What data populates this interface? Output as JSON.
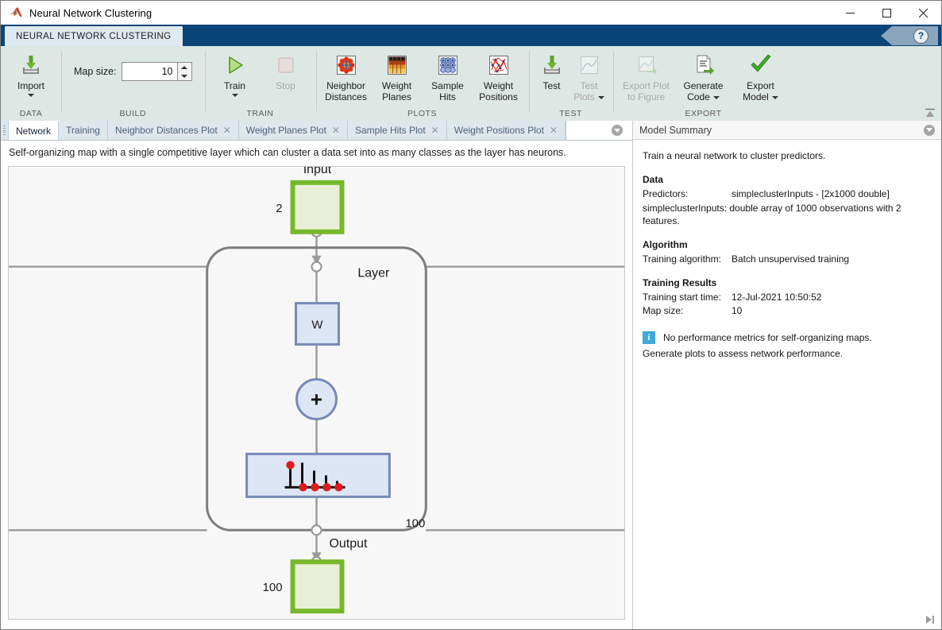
{
  "window": {
    "title": "Neural Network Clustering",
    "app_icon": "matlab-icon",
    "minimize": "–",
    "maximize": "☐",
    "close": "✕"
  },
  "ribbon": {
    "tab_label": "NEURAL NETWORK CLUSTERING",
    "help_label": "?",
    "collapse_label": "collapse-ribbon-icon",
    "groups": [
      {
        "title": "DATA",
        "items": [
          {
            "label": "Import",
            "icon": "import-data-icon",
            "has_caret": true,
            "disabled": false
          }
        ]
      },
      {
        "title": "BUILD",
        "field": {
          "label": "Map size:",
          "value": "10",
          "placeholder": "10"
        }
      },
      {
        "title": "TRAIN",
        "items": [
          {
            "label": "Train",
            "icon": "play-triangle-icon",
            "has_caret": true,
            "disabled": false
          },
          {
            "label": "Stop",
            "icon": "stop-square-icon",
            "has_caret": false,
            "disabled": true
          }
        ]
      },
      {
        "title": "PLOTS",
        "items": [
          {
            "label": "Neighbor\nDistances",
            "label_line1": "Neighbor",
            "label_line2": "Distances",
            "icon": "neighbor-distances-icon",
            "disabled": false
          },
          {
            "label": "Weight Planes",
            "label_line1": "Weight",
            "label_line2": "Planes",
            "icon": "weight-planes-icon",
            "disabled": false
          },
          {
            "label": "Sample Hits",
            "label_line1": "Sample",
            "label_line2": "Hits",
            "icon": "sample-hits-icon",
            "disabled": false
          },
          {
            "label": "Weight Positions",
            "label_line1": "Weight",
            "label_line2": "Positions",
            "icon": "weight-positions-icon",
            "disabled": false
          }
        ]
      },
      {
        "title": "TEST",
        "items": [
          {
            "label": "Test",
            "label_line1": "Test",
            "label_line2": "",
            "icon": "test-import-icon",
            "disabled": false
          },
          {
            "label": "Test Plots",
            "label_line1": "Test",
            "label_line2": "Plots",
            "icon": "test-plots-icon",
            "has_caret": true,
            "disabled": true
          }
        ]
      },
      {
        "title": "EXPORT",
        "items": [
          {
            "label": "Export Plot to Figure",
            "label_line1": "Export Plot",
            "label_line2": "to Figure",
            "icon": "export-plot-icon",
            "disabled": true
          },
          {
            "label": "Generate Code",
            "label_line1": "Generate",
            "label_line2": "Code",
            "icon": "generate-code-icon",
            "has_caret": true,
            "disabled": false
          },
          {
            "label": "Export Model",
            "label_line1": "Export",
            "label_line2": "Model",
            "icon": "export-model-check-icon",
            "has_caret": true,
            "disabled": false
          }
        ]
      }
    ]
  },
  "document_tabs": {
    "overflow_icon": "tab-overflow-icon",
    "items": [
      {
        "label": "Network",
        "active": true,
        "closable": false
      },
      {
        "label": "Training",
        "active": false,
        "closable": false
      },
      {
        "label": "Neighbor Distances Plot",
        "active": false,
        "closable": true
      },
      {
        "label": "Weight Planes Plot",
        "active": false,
        "closable": true
      },
      {
        "label": "Sample Hits Plot",
        "active": false,
        "closable": true
      },
      {
        "label": "Weight Positions Plot",
        "active": false,
        "closable": true
      }
    ],
    "close_glyph": "✕"
  },
  "description": "Self-organizing map with a single competitive layer which can cluster a data set into as many classes as the layer has neurons.",
  "diagram": {
    "input_label": "Input",
    "input_size": "2",
    "layer_label": "Layer",
    "weight_label": "W",
    "sum_label": "+",
    "layer_size": "100",
    "output_label": "Output",
    "output_size": "100",
    "transfer_icon": "compet-transfer-function-icon",
    "colors": {
      "input_block_border": "#76b82a",
      "input_block_fill": "#e9efd6",
      "op_block_border": "#7689b8",
      "op_block_fill": "#dde6f5",
      "wire": "#9a9a9a",
      "layer_border": "#7d7d7d"
    }
  },
  "summary": {
    "header": "Model Summary",
    "collapse_icon": "summary-collapse-icon",
    "intro": "Train a neural network to cluster predictors.",
    "data_heading": "Data",
    "predictors_key": "Predictors:",
    "predictors_value": "simpleclusterInputs - [2x1000 double]",
    "predictors_note": "simpleclusterInputs: double array of 1000 observations with 2 features.",
    "algorithm_heading": "Algorithm",
    "algorithm_key": "Training algorithm:",
    "algorithm_value": "Batch unsupervised training",
    "results_heading": "Training Results",
    "start_time_key": "Training start time:",
    "start_time_value": "12-Jul-2021 10:50:52",
    "map_size_key": "Map size:",
    "map_size_value": "10",
    "info_glyph": "i",
    "info_line1": "No performance metrics for self-organizing maps.",
    "info_line2": "Generate plots to assess network performance.",
    "scroll_end_icon": "scroll-to-end-icon"
  }
}
